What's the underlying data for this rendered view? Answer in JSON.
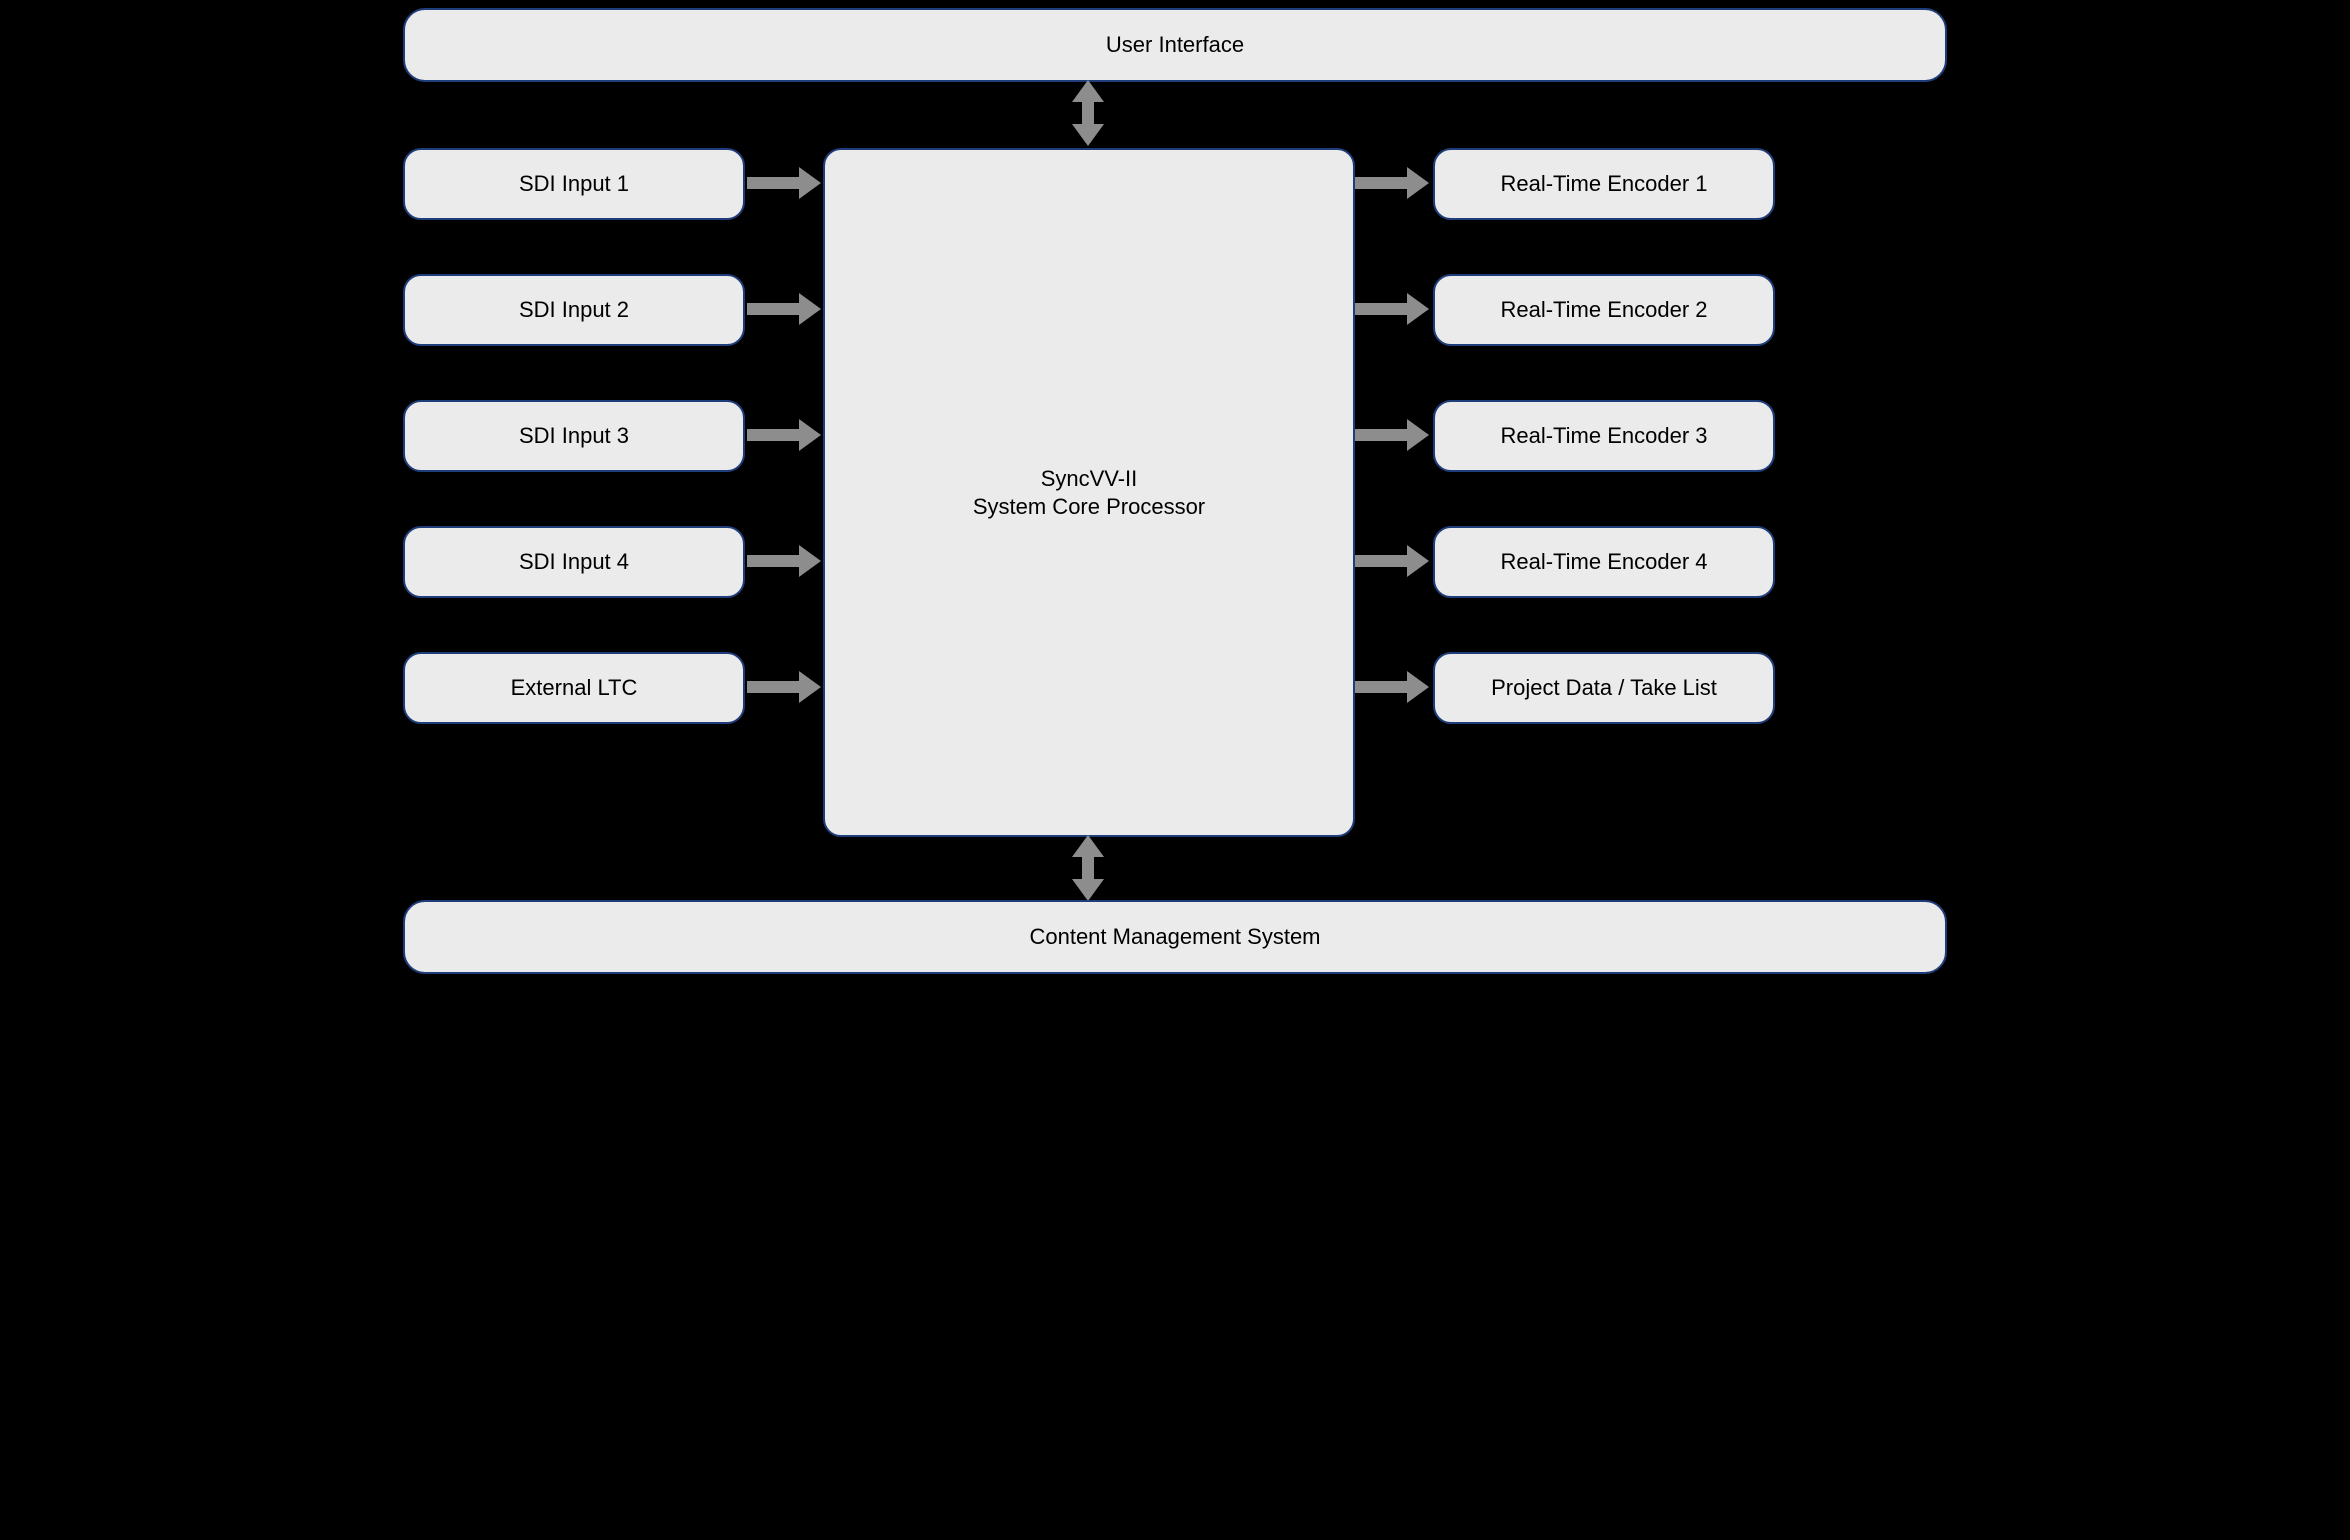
{
  "top": {
    "label": "User Interface"
  },
  "bottom": {
    "label": "Content Management System"
  },
  "center": {
    "line1": "SyncVV-II",
    "line2": "System Core Processor"
  },
  "left": [
    {
      "label": "SDI Input 1"
    },
    {
      "label": "SDI Input 2"
    },
    {
      "label": "SDI Input 3"
    },
    {
      "label": "SDI Input 4"
    },
    {
      "label": "External LTC"
    }
  ],
  "right": [
    {
      "label": "Real-Time Encoder 1"
    },
    {
      "label": "Real-Time Encoder 2"
    },
    {
      "label": "Real-Time Encoder 3"
    },
    {
      "label": "Real-Time Encoder 4"
    },
    {
      "label": "Project Data / Take List"
    }
  ]
}
